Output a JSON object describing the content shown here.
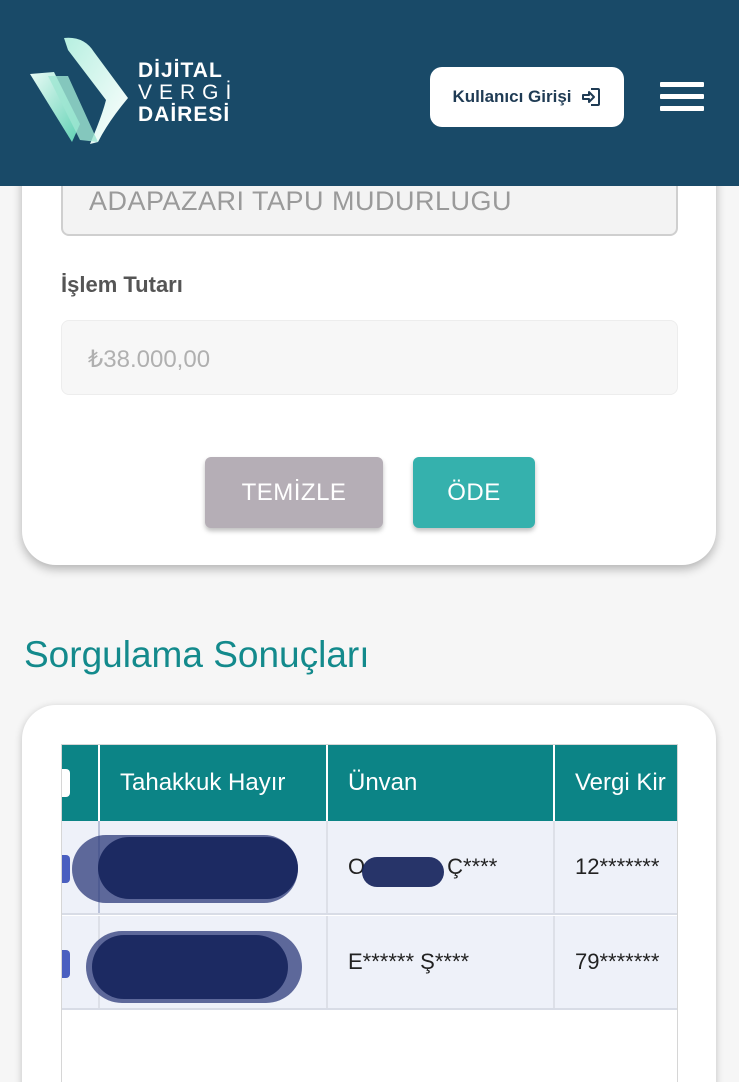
{
  "header": {
    "brand_line1": "DİJİTAL",
    "brand_line2": "VERGİ",
    "brand_line3": "DAİRESİ",
    "login_label": "Kullanıcı Girişi",
    "login_icon": "login-arrow-icon",
    "menu_icon": "hamburger-menu-icon",
    "background_color": "#194a68"
  },
  "form": {
    "office_value": "ADAPAZARI TAPU MUDURLUGU",
    "amount_label": "İşlem Tutarı",
    "amount_value": "₺38.000,00",
    "clear_label": "TEMİZLE",
    "pay_label": "ÖDE",
    "clear_color": "#b5aeb6",
    "pay_color": "#35b1ad"
  },
  "results": {
    "title": "Sorgulama Sonuçları",
    "columns": [
      "Tahakkuk Hayır",
      "Ünvan",
      "Vergi Kir"
    ],
    "rows": [
      {
        "unvan_prefix": "O",
        "unvan_suffix": "Ç****",
        "vergi": "12*******"
      },
      {
        "unvan": "E****** Ş****",
        "vergi": "79*******"
      }
    ],
    "header_color": "#0c8486"
  }
}
